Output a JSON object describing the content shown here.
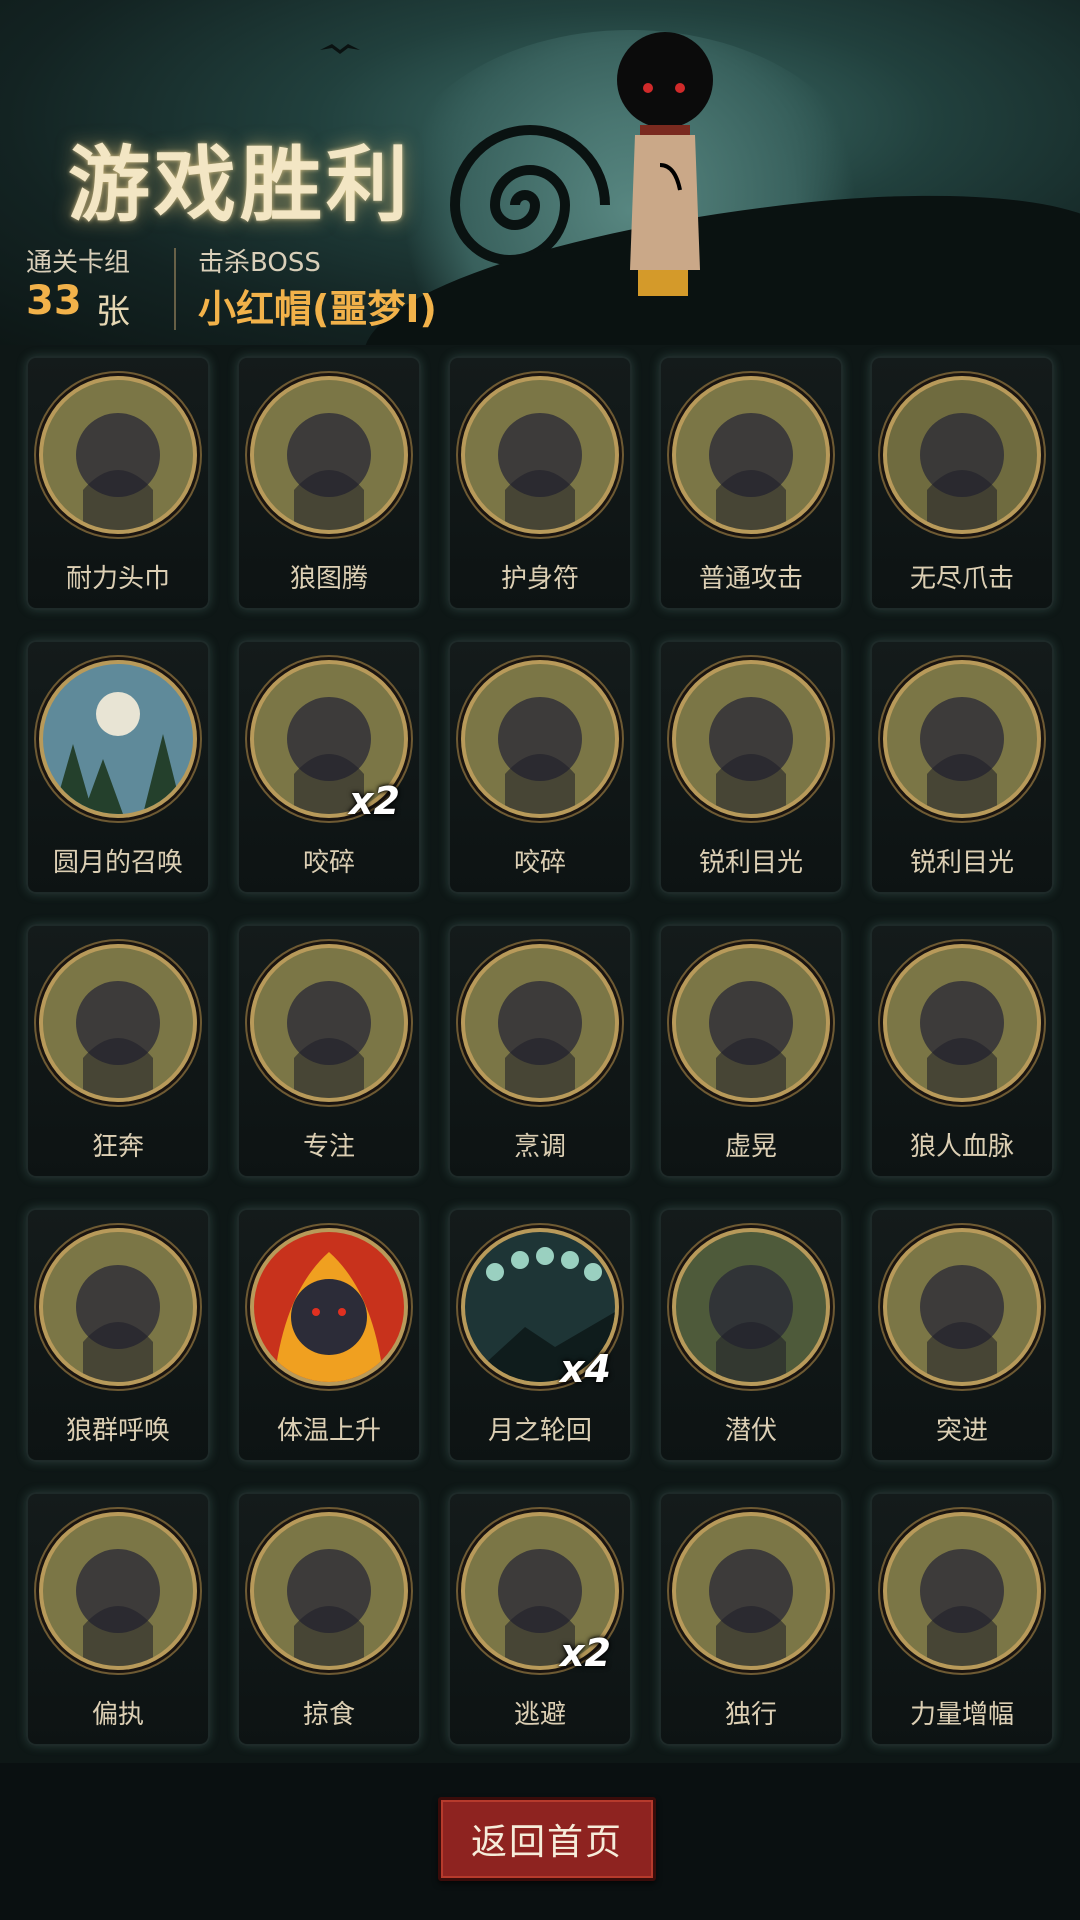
{
  "header": {
    "title": "游戏胜利",
    "cleared_deck_label": "通关卡组",
    "cleared_deck_count": "33",
    "cleared_deck_unit": "张",
    "boss_label": "击杀BOSS",
    "boss_name": "小红帽(噩梦I)"
  },
  "cards": [
    {
      "name": "耐力头巾",
      "count": "",
      "icon": "bandana-icon",
      "color": "#7b7646"
    },
    {
      "name": "狼图腾",
      "count": "",
      "icon": "wolf-totem-icon",
      "color": "#7b7646"
    },
    {
      "name": "护身符",
      "count": "",
      "icon": "amulet-shield-icon",
      "color": "#7b7646"
    },
    {
      "name": "普通攻击",
      "count": "",
      "icon": "axe-slash-icon",
      "color": "#7b7646"
    },
    {
      "name": "无尽爪击",
      "count": "",
      "icon": "claw-icon",
      "color": "#6f6b3f"
    },
    {
      "name": "圆月的召唤",
      "count": "",
      "icon": "full-moon-icon",
      "color": "#5f8a9a"
    },
    {
      "name": "咬碎",
      "count": "x2",
      "icon": "bite-icon",
      "color": "#7b7646"
    },
    {
      "name": "咬碎",
      "count": "",
      "icon": "bite-icon",
      "color": "#7b7646"
    },
    {
      "name": "锐利目光",
      "count": "",
      "icon": "werewolf-face-icon",
      "color": "#7b7646"
    },
    {
      "name": "锐利目光",
      "count": "",
      "icon": "werewolf-face-icon",
      "color": "#7b7646"
    },
    {
      "name": "狂奔",
      "count": "",
      "icon": "running-wolf-icon",
      "color": "#7b7646"
    },
    {
      "name": "专注",
      "count": "",
      "icon": "wizard-icon",
      "color": "#7b7646"
    },
    {
      "name": "烹调",
      "count": "",
      "icon": "fox-chef-icon",
      "color": "#7b7646"
    },
    {
      "name": "虚晃",
      "count": "",
      "icon": "boxer-icon",
      "color": "#7b7646"
    },
    {
      "name": "狼人血脉",
      "count": "",
      "icon": "werewolf-hand-icon",
      "color": "#7b7646"
    },
    {
      "name": "狼群呼唤",
      "count": "",
      "icon": "wolf-pack-icon",
      "color": "#7b7646"
    },
    {
      "name": "体温上升",
      "count": "",
      "icon": "fire-werewolf-icon",
      "color": "#c8321c"
    },
    {
      "name": "月之轮回",
      "count": "x4",
      "icon": "moon-phases-icon",
      "color": "#1e3536"
    },
    {
      "name": "潜伏",
      "count": "",
      "icon": "lurking-wolf-icon",
      "color": "#4e5a3a"
    },
    {
      "name": "突进",
      "count": "",
      "icon": "charging-wolf-icon",
      "color": "#7b7646"
    },
    {
      "name": "偏执",
      "count": "",
      "icon": "wolf-bear-icon",
      "color": "#7b7646"
    },
    {
      "name": "掠食",
      "count": "",
      "icon": "predator-icon",
      "color": "#7b7646"
    },
    {
      "name": "逃避",
      "count": "x2",
      "icon": "escape-bear-icon",
      "color": "#7b7646"
    },
    {
      "name": "独行",
      "count": "",
      "icon": "lone-hero-icon",
      "color": "#7b7646"
    },
    {
      "name": "力量增幅",
      "count": "",
      "icon": "log-lift-icon",
      "color": "#7b7646"
    }
  ],
  "footer": {
    "back_button_label": "返回首页"
  }
}
